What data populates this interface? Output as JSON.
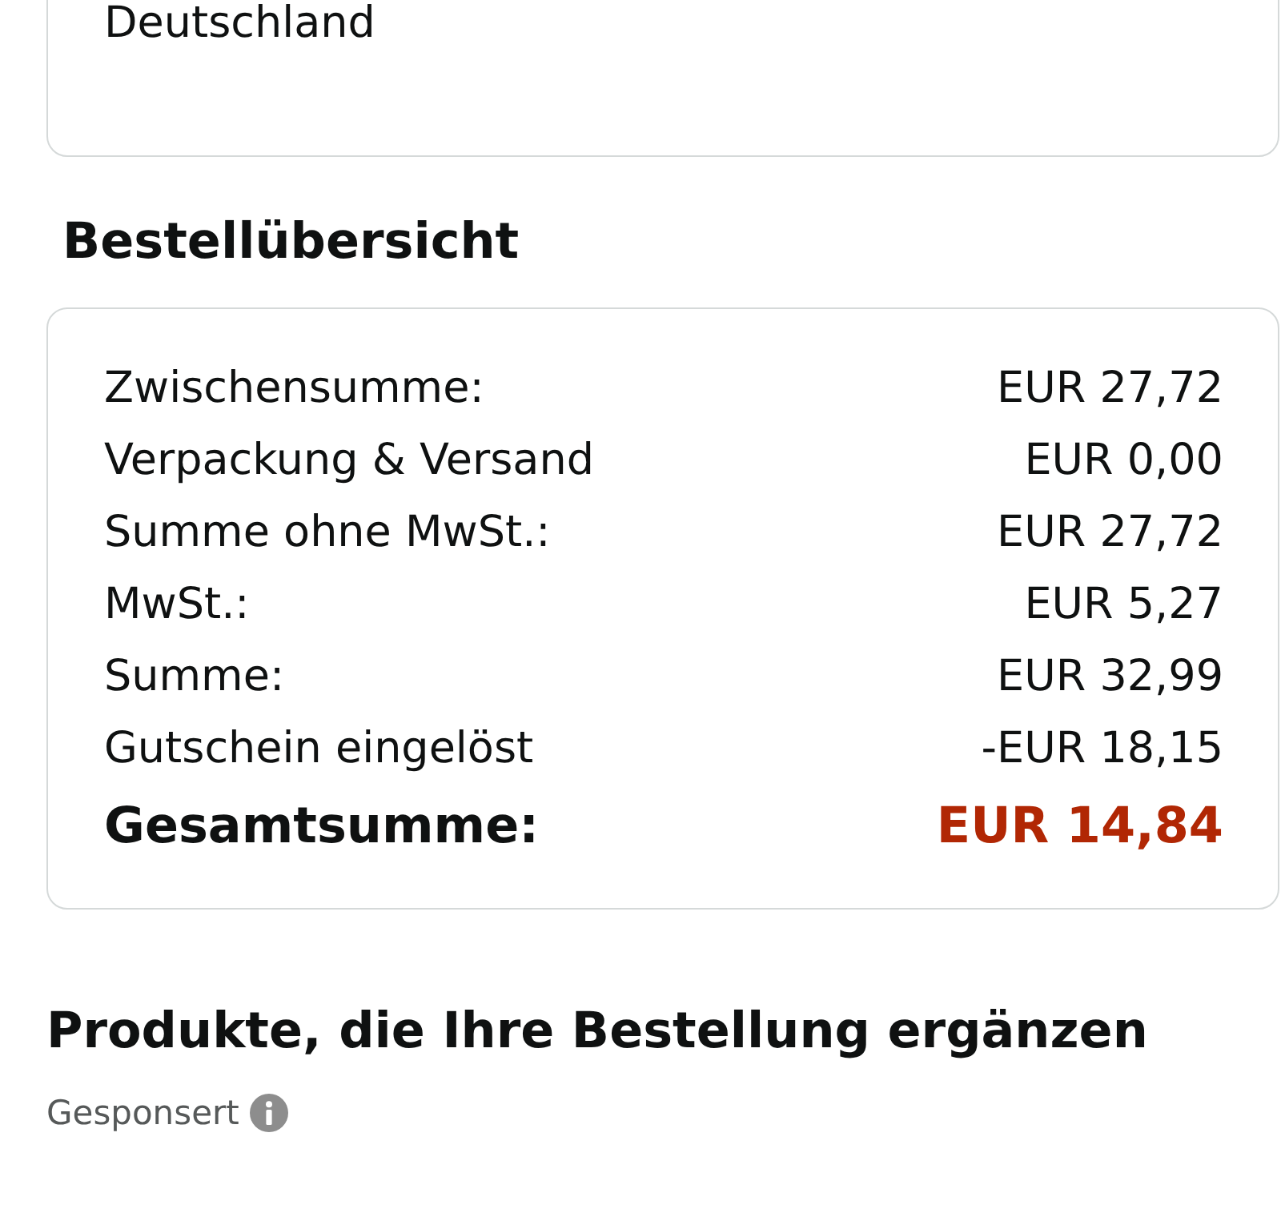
{
  "address_card": {
    "country": "Deutschland"
  },
  "order_summary": {
    "title": "Bestellübersicht",
    "rows": [
      {
        "label": "Zwischensumme:",
        "value": "EUR 27,72"
      },
      {
        "label": "Verpackung & Versand",
        "value": "EUR 0,00"
      },
      {
        "label": "Summe ohne MwSt.:",
        "value": "EUR 27,72"
      },
      {
        "label": "MwSt.:",
        "value": "EUR 5,27"
      },
      {
        "label": "Summe:",
        "value": "EUR 32,99"
      },
      {
        "label": "Gutschein eingelöst",
        "value": "-EUR 18,15"
      }
    ],
    "total": {
      "label": "Gesamtsumme:",
      "value": "EUR 14,84"
    }
  },
  "recommendations": {
    "title": "Produkte, die Ihre Bestellung ergänzen",
    "sponsored_label": "Gesponsert"
  }
}
